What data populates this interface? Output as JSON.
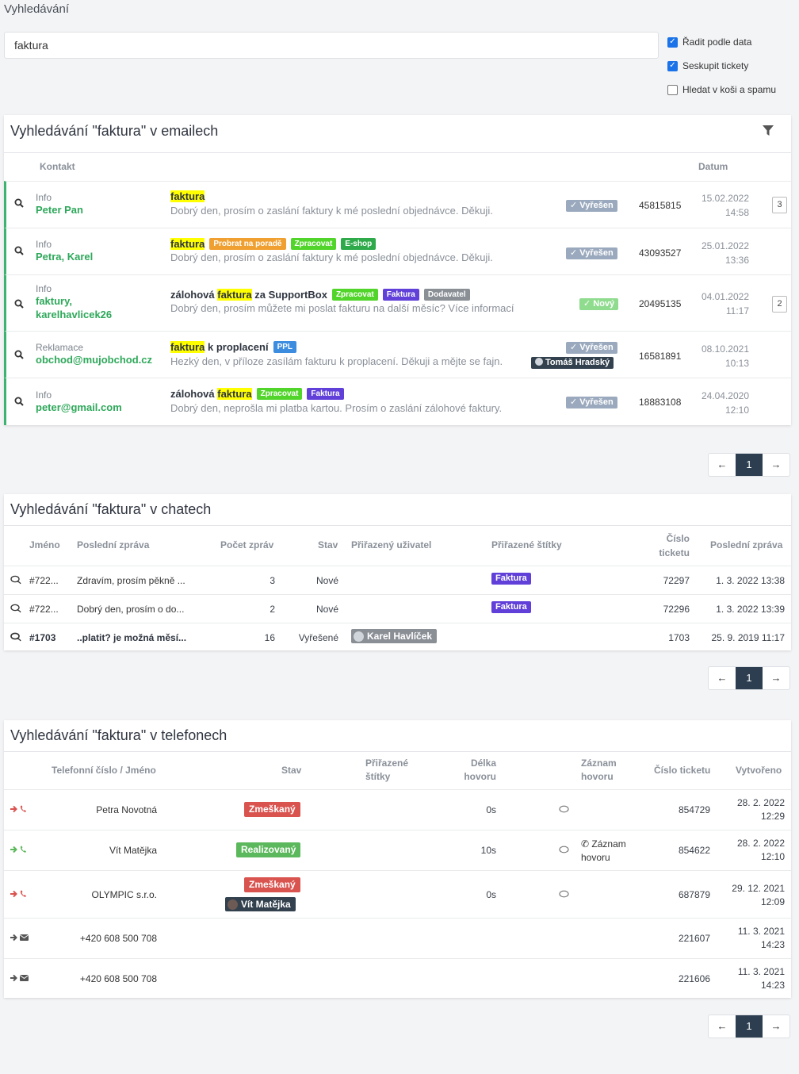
{
  "page": {
    "title": "Vyhledávání"
  },
  "search": {
    "value": "faktura"
  },
  "options": [
    {
      "label": "Řadit podle data",
      "checked": true
    },
    {
      "label": "Seskupit tickety",
      "checked": true
    },
    {
      "label": "Hledat v koši a spamu",
      "checked": false
    }
  ],
  "emails": {
    "title": "Vyhledávání \"faktura\" v emailech",
    "headers": {
      "contact": "Kontakt",
      "date": "Datum"
    },
    "rows": [
      {
        "tag": "Info",
        "name": "Peter Pan",
        "subj_pre": "",
        "subj_hl": "faktura",
        "subj_post": "",
        "labels": [],
        "snippet": "Dobrý den,  prosím o zaslání faktury k mé poslední objednávce.  Děkuji.",
        "status": "✓ Vyřešen",
        "ticket": "45815815",
        "date": "15.02.2022",
        "time": "14:58",
        "count": "3"
      },
      {
        "tag": "Info",
        "name": "Petra, Karel",
        "subj_pre": "",
        "subj_hl": "faktura",
        "subj_post": "",
        "labels": [
          "Probrat na poradě",
          "Zpracovat",
          "E-shop"
        ],
        "snippet": "Dobrý den,  prosím o zaslání faktury k mé poslední objednávce.  Děkuji.",
        "status": "✓ Vyřešen",
        "ticket": "43093527",
        "date": "25.01.2022",
        "time": "13:36",
        "count": ""
      },
      {
        "tag": "Info",
        "name": "faktury,",
        "name2": "karelhavlicek26",
        "subj_pre": "zálohová ",
        "subj_hl": "faktura",
        "subj_post": " za SupportBox",
        "labels": [
          "Zpracovat",
          "Faktura",
          "Dodavatel"
        ],
        "snippet": "Dobrý den, prosím můžete mi poslat fakturu na další měsíc? Více informací",
        "status": "✓ Nový",
        "ticket": "20495135",
        "date": "04.01.2022",
        "time": "11:17",
        "count": "2"
      },
      {
        "tag": "Reklamace",
        "name": "obchod@mujobchod.cz",
        "subj_pre": "",
        "subj_hl": "faktura",
        "subj_post": " k proplacení",
        "labels": [
          "PPL"
        ],
        "snippet": "Hezký den, v příloze zasílám fakturu k proplacení. Děkuji a mějte se fajn.",
        "status": "✓ Vyřešen",
        "assignee": "Tomáš Hradský",
        "ticket": "16581891",
        "date": "08.10.2021",
        "time": "10:13",
        "count": ""
      },
      {
        "tag": "Info",
        "name": "peter@gmail.com",
        "subj_pre": "zálohová ",
        "subj_hl": "faktura",
        "subj_post": "",
        "labels": [
          "Zpracovat",
          "Faktura"
        ],
        "snippet": "Dobrý den, neprošla mi platba kartou. Prosím o zaslání zálohové faktury.",
        "status": "✓ Vyřešen",
        "ticket": "18883108",
        "date": "24.04.2020",
        "time": "12:10",
        "count": ""
      }
    ]
  },
  "pager": {
    "prev": "←",
    "page": "1",
    "next": "→"
  },
  "chats": {
    "title": "Vyhledávání \"faktura\" v chatech",
    "headers": {
      "name": "Jméno",
      "last_msg": "Poslední zpráva",
      "count": "Počet zpráv",
      "state": "Stav",
      "assigned": "Přiřazený uživatel",
      "labels": "Přiřazené štítky",
      "ticket1": "Číslo",
      "ticket2": "ticketu",
      "last": "Poslední zpráva"
    },
    "rows": [
      {
        "id": "#722...",
        "msg": "Zdravím, prosím pěkně ...",
        "count": "3",
        "state": "Nové",
        "user": "",
        "label": "Faktura",
        "ticket": "72297",
        "last": "1. 3. 2022 13:38",
        "bold": false
      },
      {
        "id": "#722...",
        "msg": "Dobrý den, prosím o do...",
        "count": "2",
        "state": "Nové",
        "user": "",
        "label": "Faktura",
        "ticket": "72296",
        "last": "1. 3. 2022 13:39",
        "bold": false
      },
      {
        "id": "#1703",
        "msg": "..platit? je možná měsí...",
        "count": "16",
        "state": "Vyřešené",
        "user": "Karel Havlíček",
        "label": "",
        "ticket": "1703",
        "last": "25. 9. 2019 11:17",
        "bold": true
      }
    ]
  },
  "phones": {
    "title": "Vyhledávání \"faktura\" v telefonech",
    "headers": {
      "name": "Telefonní číslo / Jméno",
      "state": "Stav",
      "labels1": "Přiřazené",
      "labels2": "štítky",
      "len1": "Délka",
      "len2": "hovoru",
      "rec1": "Záznam",
      "rec2": "hovoru",
      "ticket": "Číslo ticketu",
      "created": "Vytvořeno"
    },
    "rows": [
      {
        "kind": "call-missed",
        "name": "Petra Novotná",
        "state": "Zmeškaný",
        "assignee": "",
        "len": "0s",
        "rec1": "",
        "rec2": "",
        "ticket": "854729",
        "date": "28. 2. 2022",
        "time": "12:29"
      },
      {
        "kind": "call-ok",
        "name": "Vít Matějka",
        "state": "Realizovaný",
        "assignee": "",
        "len": "10s",
        "rec1": "Záznam",
        "rec2": "hovoru",
        "ticket": "854622",
        "date": "28. 2. 2022",
        "time": "12:10"
      },
      {
        "kind": "call-missed",
        "name": "OLYMPIC s.r.o.",
        "state": "Zmeškaný",
        "assignee": "Vít Matějka",
        "len": "0s",
        "rec1": "",
        "rec2": "",
        "ticket": "687879",
        "date": "29. 12. 2021",
        "time": "12:09"
      },
      {
        "kind": "sms",
        "name": "+420 608 500 708",
        "state": "",
        "assignee": "",
        "len": "",
        "rec1": "",
        "rec2": "",
        "ticket": "221607",
        "date": "11. 3. 2021",
        "time": "14:23"
      },
      {
        "kind": "sms",
        "name": "+420 608 500 708",
        "state": "",
        "assignee": "",
        "len": "",
        "rec1": "",
        "rec2": "",
        "ticket": "221606",
        "date": "11. 3. 2021",
        "time": "14:23"
      }
    ]
  },
  "colors": {
    "accent_green": "#2ea85a",
    "resolved": "#9aa9bd",
    "new": "#8fdc8f",
    "missed": "#e05a5a",
    "realized": "#5cb85c",
    "label_faktura": "#6040d8",
    "label_zpracovat": "#52d52a",
    "label_probrat": "#f0a030",
    "label_eshop": "#2eaa4a",
    "label_dodavatel": "#8a8f96",
    "label_ppl": "#3c8ce0",
    "pager_active": "#2c3e50"
  }
}
